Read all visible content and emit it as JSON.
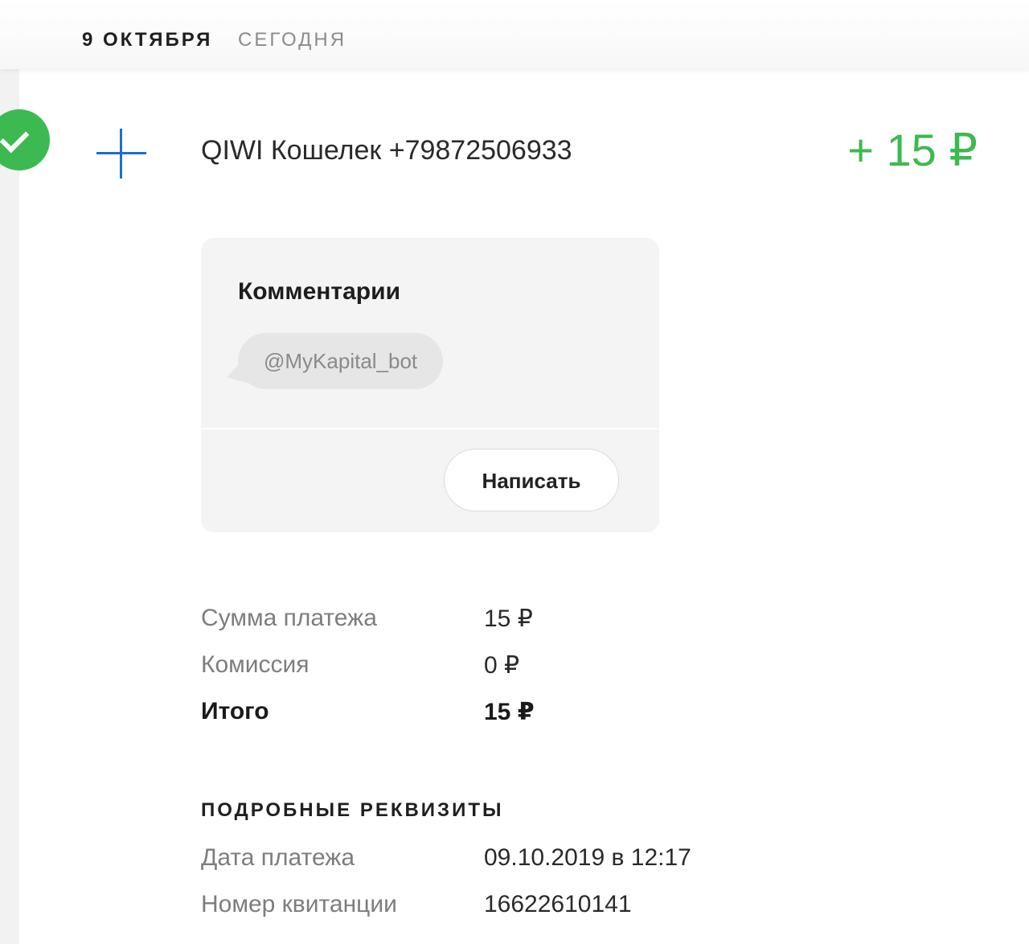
{
  "date_header": {
    "day": "9 ОКТЯБРЯ",
    "relative": "СЕГОДНЯ"
  },
  "transaction": {
    "status_icon": "check-circle-icon",
    "type_icon": "plus-icon",
    "title": "QIWI Кошелек +79872506933",
    "amount": "+ 15 ₽"
  },
  "comments": {
    "title": "Комментарии",
    "items": [
      "@MyKapital_bot"
    ],
    "write_label": "Написать"
  },
  "summary": {
    "rows": [
      {
        "label": "Сумма платежа",
        "value": "15 ₽"
      },
      {
        "label": "Комиссия",
        "value": "0 ₽"
      },
      {
        "label": "Итого",
        "value": "15 ₽"
      }
    ]
  },
  "details": {
    "title": "ПОДРОБНЫЕ РЕКВИЗИТЫ",
    "rows": [
      {
        "label": "Дата платежа",
        "value": "09.10.2019 в 12:17"
      },
      {
        "label": "Номер квитанции",
        "value": "16622610141"
      }
    ]
  },
  "colors": {
    "accent_green": "#3cb950",
    "icon_blue": "#1a6fd4"
  }
}
